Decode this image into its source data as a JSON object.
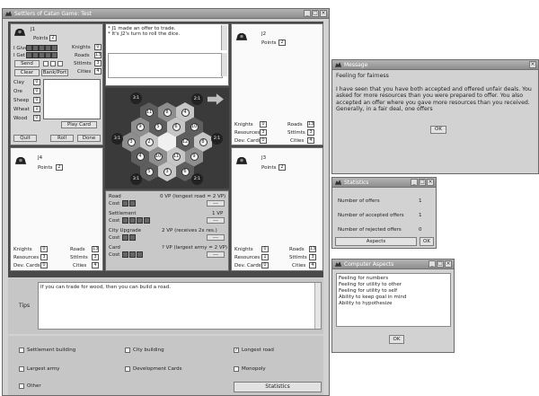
{
  "main_window": {
    "title": "Settlers of Catan Game: Test"
  },
  "log": {
    "lines": [
      "* J1 made an offer to trade.",
      "* It's J2's turn to roll the dice."
    ]
  },
  "player1": {
    "name": "J1",
    "points_label": "Points",
    "points": "2",
    "give_label": "I Give",
    "get_label": "I Get",
    "send_label": "Send",
    "clear_label": "Clear",
    "bank_label": "Bank/Port",
    "knights_label": "Knights",
    "knights": "0",
    "roads_label": "Roads",
    "roads": "13",
    "sttlmts_label": "Sttlmts",
    "sttlmts": "3",
    "cities_label": "Cities",
    "cities": "4",
    "resources": [
      {
        "name": "Clay",
        "value": "0"
      },
      {
        "name": "Ore",
        "value": "0"
      },
      {
        "name": "Sheep",
        "value": "0"
      },
      {
        "name": "Wheat",
        "value": "1"
      },
      {
        "name": "Wood",
        "value": "0"
      }
    ],
    "play_card_label": "Play Card",
    "quit_label": "Quit",
    "roll_label": "Roll",
    "done_label": "Done"
  },
  "player2": {
    "name": "J2",
    "points_label": "Points",
    "points": "2",
    "knights_label": "Knights",
    "knights": "0",
    "resources_label": "Resources",
    "resources": "3",
    "dev_label": "Dev. Cards",
    "dev": "0",
    "roads_label": "Roads",
    "roads": "13",
    "sttlmts_label": "Sttlmts",
    "sttlmts": "3",
    "cities_label": "Cities",
    "cities": "4"
  },
  "player3": {
    "name": "J3",
    "points_label": "Points",
    "points": "2",
    "knights_label": "Knights",
    "knights": "0",
    "resources_label": "Resources",
    "resources": "1",
    "dev_label": "Dev. Cards",
    "dev": "0",
    "roads_label": "Roads",
    "roads": "13",
    "sttlmts_label": "Sttlmts",
    "sttlmts": "3",
    "cities_label": "Cities",
    "cities": "4"
  },
  "player4": {
    "name": "J4",
    "points_label": "Points",
    "points": "2",
    "knights_label": "Knights",
    "knights": "0",
    "resources_label": "Resources",
    "resources": "3",
    "dev_label": "Dev. Cards",
    "dev": "0",
    "roads_label": "Roads",
    "roads": "13",
    "sttlmts_label": "Sttlmts",
    "sttlmts": "3",
    "cities_label": "Cities",
    "cities": "4"
  },
  "build": {
    "road_label": "Road",
    "road_vp": "0 VP (longest road = 2 VP)",
    "settlement_label": "Settlement",
    "settlement_vp": "1 VP",
    "city_label": "City Upgrade",
    "city_vp": "2 VP (receives 2x res.)",
    "card_label": "Card",
    "card_vp": "? VP (largest army = 2 VP)",
    "cost_label": "Cost",
    "action_label": "---"
  },
  "board": {
    "tokens": [
      "11",
      "8",
      "4",
      "9",
      "5",
      "6",
      "10",
      "3",
      "2",
      "12",
      "8",
      "4",
      "10",
      "11",
      "9",
      "5",
      "3",
      "6"
    ],
    "ports": [
      "3:1",
      "2:1",
      "3:1",
      "2:1",
      "3:1",
      "2:1"
    ],
    "colors": {
      "sea": "#3a3a3a",
      "hex_dark": "#5e5e5e",
      "hex_mid": "#8e8e8e",
      "hex_light": "#c6c6c6",
      "desert": "#f0f0f0"
    }
  },
  "tips": {
    "label": "Tips",
    "text": "If you can trade for wood, then you can build a road."
  },
  "options": [
    {
      "label": "Settlement building",
      "checked": false
    },
    {
      "label": "City building",
      "checked": false
    },
    {
      "label": "Longest road",
      "checked": true
    },
    {
      "label": "Largest army",
      "checked": false
    },
    {
      "label": "Development Cards",
      "checked": false
    },
    {
      "label": "Monopoly",
      "checked": false
    },
    {
      "label": "Other",
      "checked": false
    }
  ],
  "statistics_button": "Statistics",
  "message_dialog": {
    "title": "Message",
    "heading": "Feeling for fairness",
    "body": "I have seen that you have both accepted and offered unfair deals. You asked for more resources than you were prepared to offer. You also accepted an offer where you gave more resources than you received. Generally, in a fair deal, one offers",
    "ok_label": "OK"
  },
  "statistics_dialog": {
    "title": "Statistics",
    "rows": [
      {
        "label": "Number of offers",
        "value": "1"
      },
      {
        "label": "Number of accepted offers",
        "value": "1"
      },
      {
        "label": "Number of rejected offers",
        "value": "0"
      }
    ],
    "aspects_label": "Aspects",
    "ok_label": "OK"
  },
  "aspects_dialog": {
    "title": "Computer Aspects",
    "items": [
      "Feeling for numbers",
      "Feeling for utility to other",
      "Feeling for utility to self",
      "Ability to keep goal in mind",
      "Ability to hypothesize"
    ],
    "ok_label": "OK"
  }
}
